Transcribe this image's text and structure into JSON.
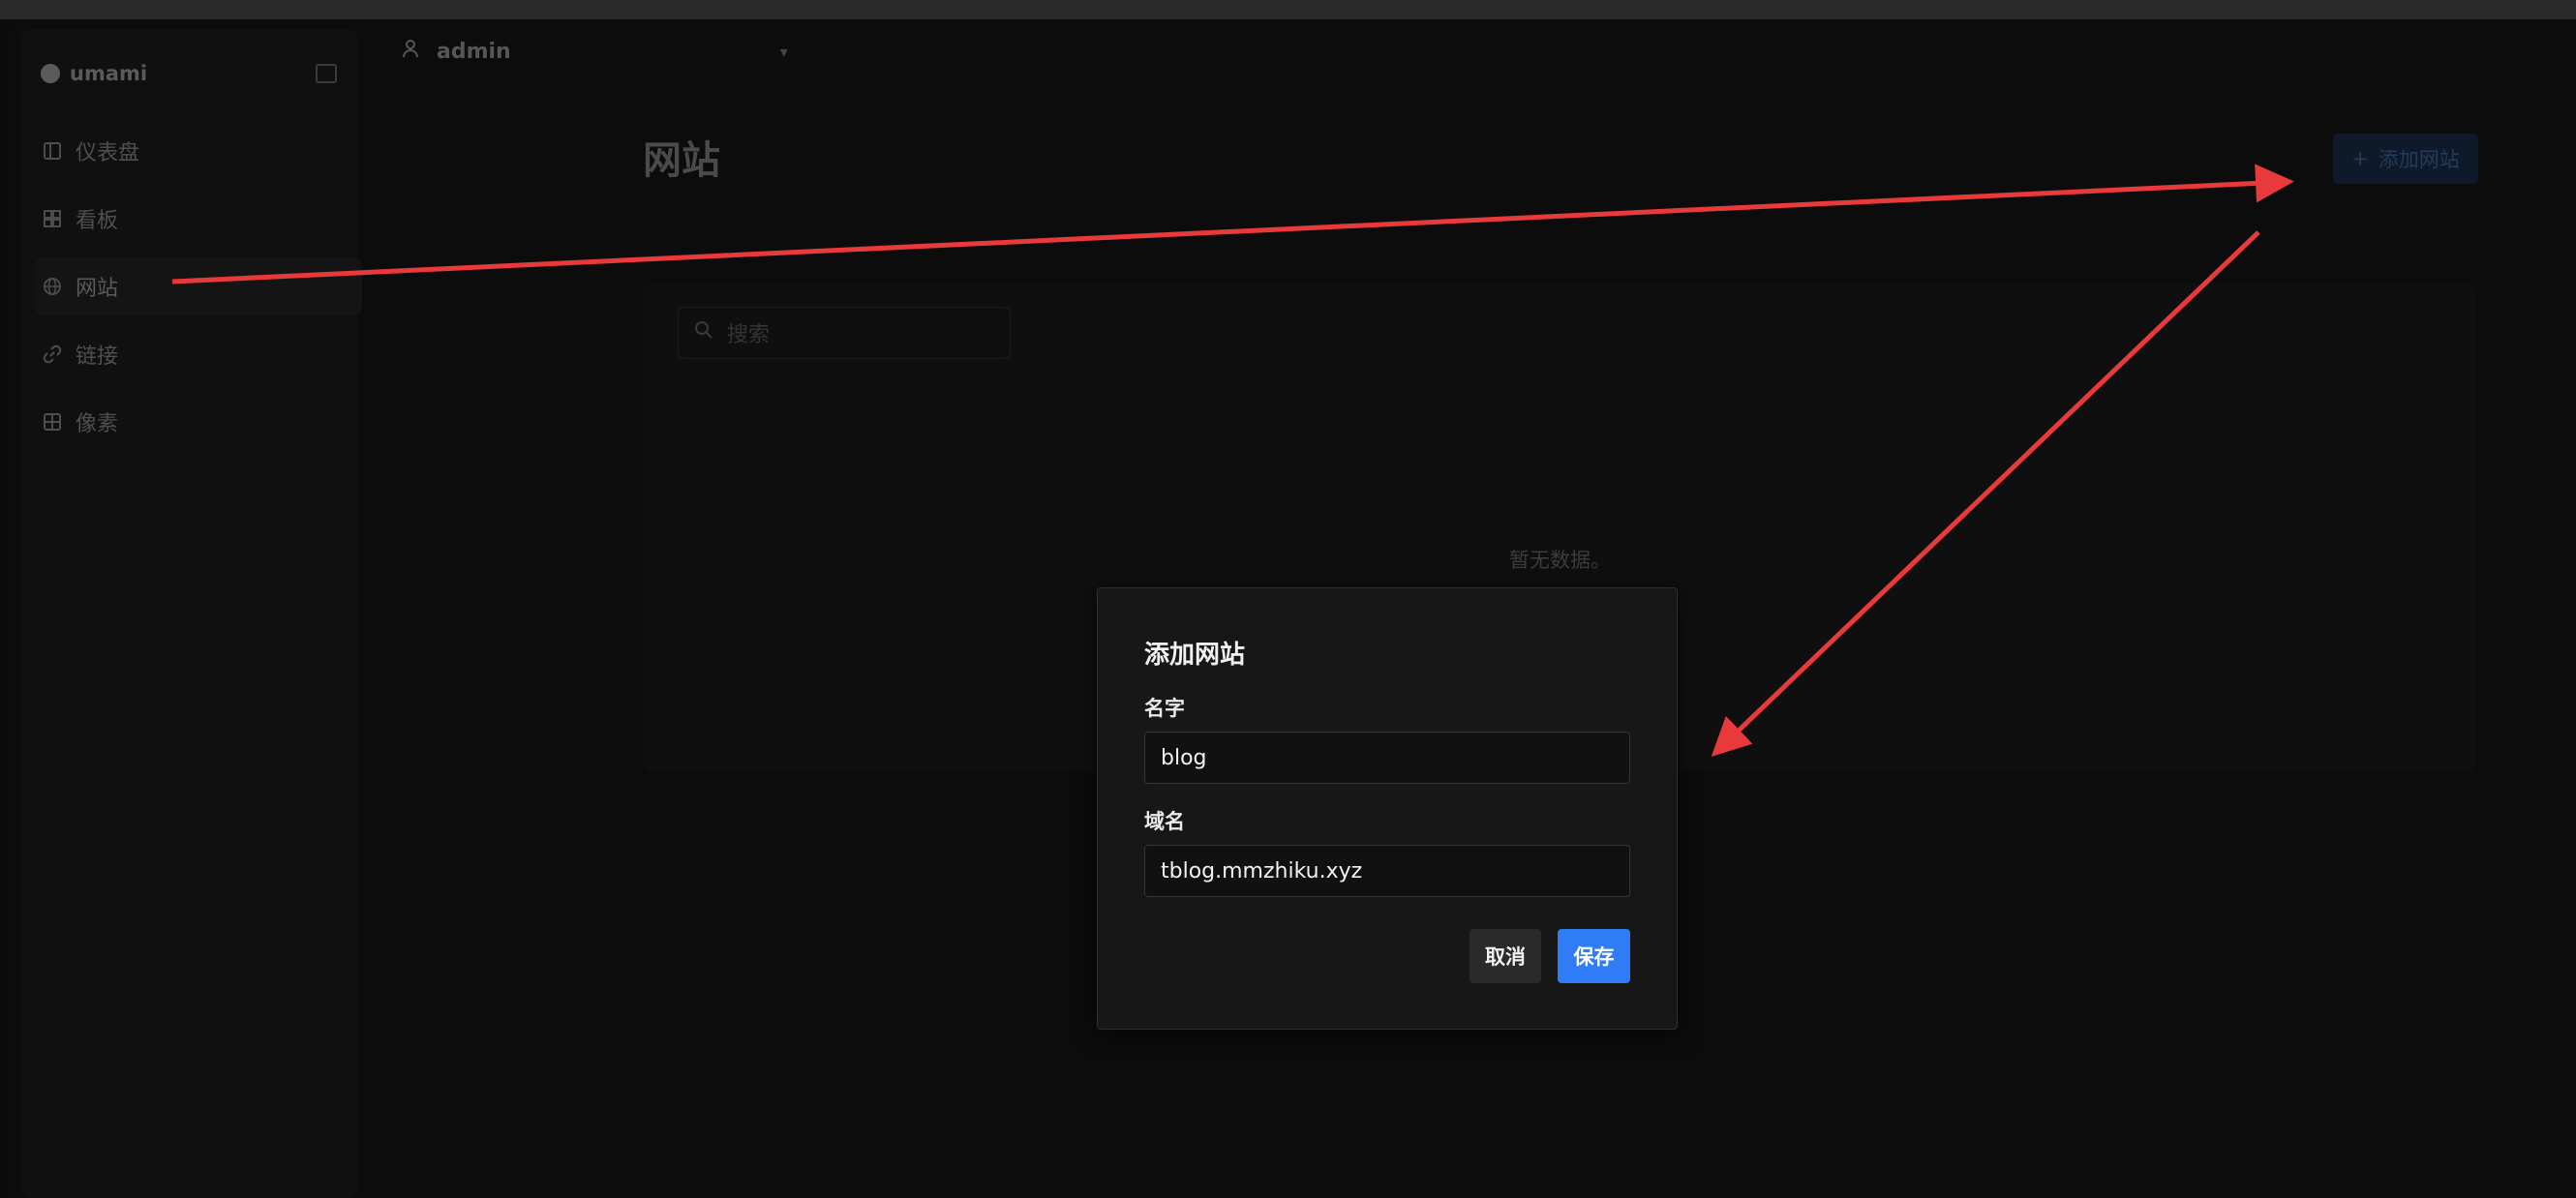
{
  "brand": {
    "name": "umami"
  },
  "sidebar": {
    "items": [
      {
        "label": "仪表盘",
        "icon": "dashboard-icon"
      },
      {
        "label": "看板",
        "icon": "board-icon"
      },
      {
        "label": "网站",
        "icon": "globe-icon",
        "active": true
      },
      {
        "label": "链接",
        "icon": "link-icon"
      },
      {
        "label": "像素",
        "icon": "grid-icon"
      }
    ]
  },
  "header": {
    "user": "admin"
  },
  "main": {
    "title": "网站",
    "add_button": "添加网站",
    "search_placeholder": "搜索",
    "empty_text": "暂无数据。"
  },
  "modal": {
    "title": "添加网站",
    "name_label": "名字",
    "name_value": "blog",
    "domain_label": "域名",
    "domain_value": "tblog.mmzhiku.xyz",
    "cancel_label": "取消",
    "save_label": "保存"
  },
  "colors": {
    "accent": "#2f7cf6",
    "annotation": "#e8393b",
    "background": "#0b0b0b"
  }
}
